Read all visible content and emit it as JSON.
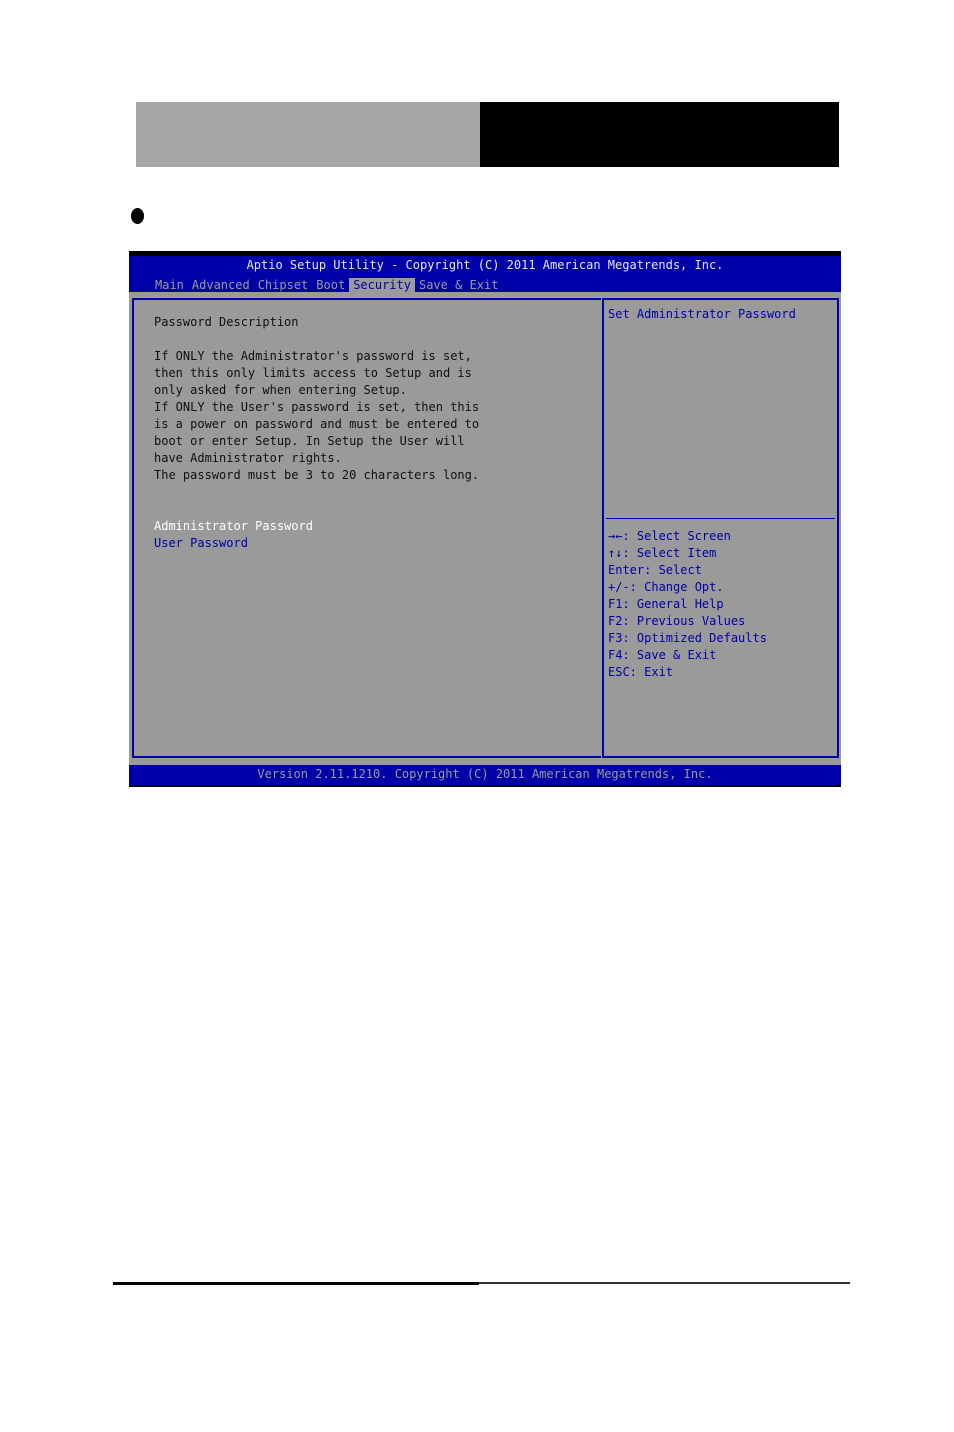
{
  "colors": {
    "bios_blue": "#0000a8",
    "bios_gray": "#9a9a9a",
    "header_gray": "#a6a6a6",
    "header_black": "#000000",
    "selected_white": "#ffffff"
  },
  "bios": {
    "title": "Aptio Setup Utility - Copyright (C) 2011 American Megatrends, Inc.",
    "tabs": [
      {
        "label": "Main",
        "active": false
      },
      {
        "label": "Advanced",
        "active": false
      },
      {
        "label": "Chipset",
        "active": false
      },
      {
        "label": "Boot",
        "active": false
      },
      {
        "label": "Security",
        "active": true
      },
      {
        "label": "Save & Exit",
        "active": false
      }
    ],
    "left_pane": {
      "description_title": "Password Description",
      "description_lines": [
        "If ONLY the Administrator's password is set,",
        "then this only limits access to Setup and is",
        "only asked for when entering Setup.",
        "If ONLY the User's password is set, then this",
        "is a power on password and must be entered to",
        "boot or enter Setup. In Setup the User will",
        "have Administrator rights.",
        "The password must be 3 to 20 characters long."
      ],
      "menu_items": [
        {
          "label": "Administrator Password",
          "selected": true
        },
        {
          "label": "User Password",
          "selected": false
        }
      ]
    },
    "right_pane": {
      "help_text": "Set Administrator Password",
      "key_hints": [
        "→←: Select Screen",
        "↑↓: Select Item",
        "Enter: Select",
        "+/-: Change Opt.",
        "F1: General Help",
        "F2: Previous Values",
        "F3: Optimized Defaults",
        "F4: Save & Exit",
        "ESC: Exit"
      ]
    },
    "footer": "Version 2.11.1210. Copyright (C) 2011 American Megatrends, Inc."
  }
}
